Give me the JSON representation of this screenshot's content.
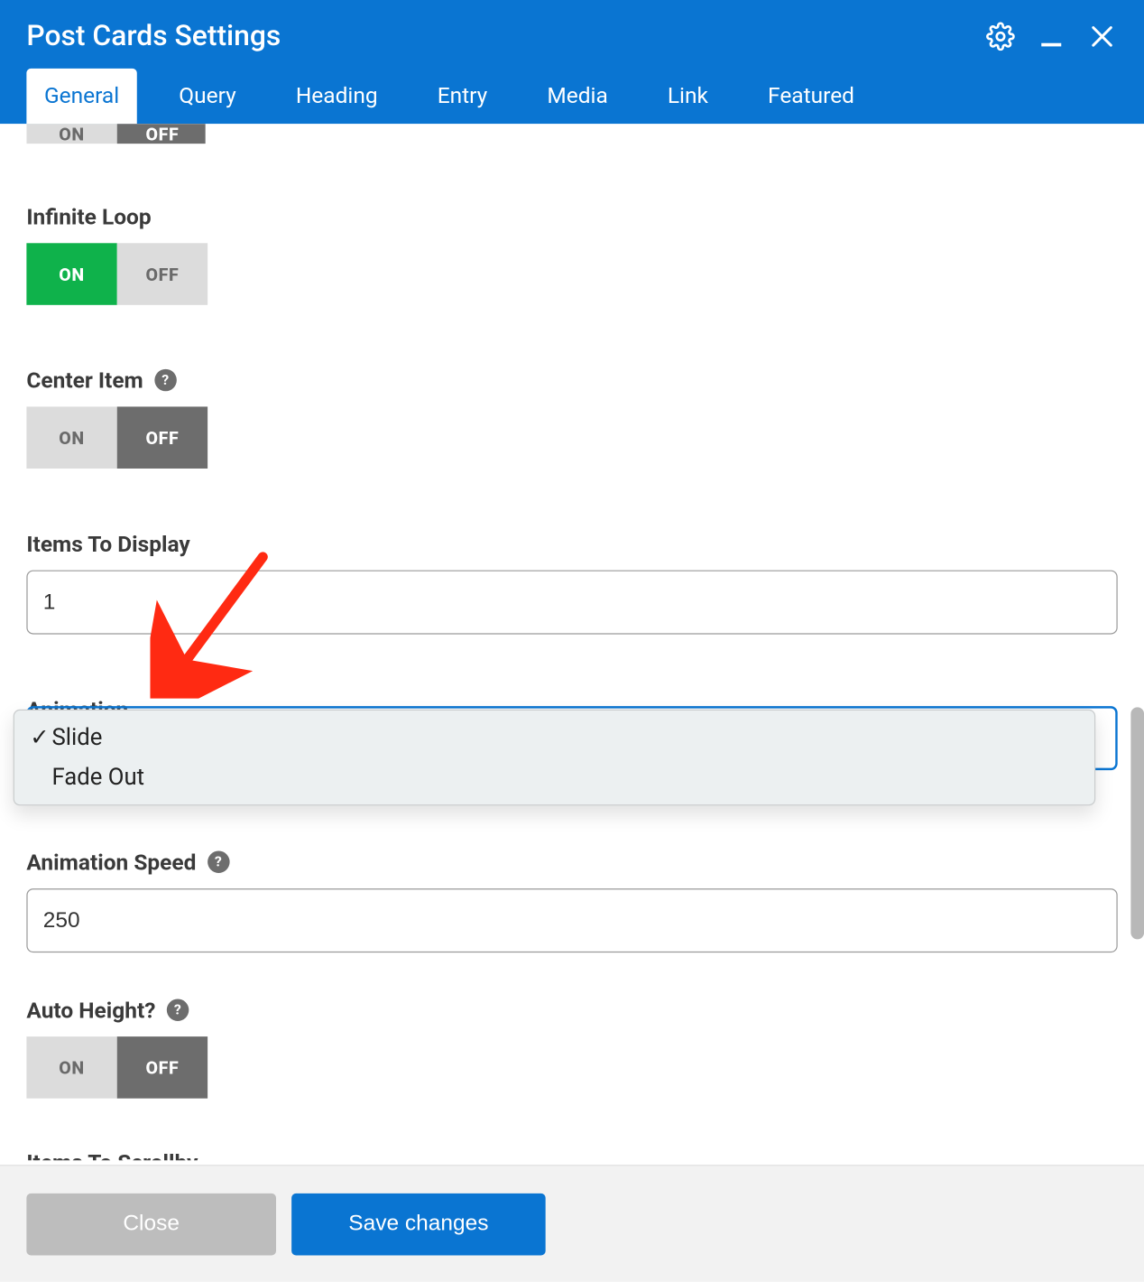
{
  "header": {
    "title": "Post Cards Settings",
    "icons": {
      "settings": "settings-icon",
      "minimize": "minimize-icon",
      "close": "close-icon"
    }
  },
  "tabs": [
    {
      "label": "General",
      "active": true
    },
    {
      "label": "Query",
      "active": false
    },
    {
      "label": "Heading",
      "active": false
    },
    {
      "label": "Entry",
      "active": false
    },
    {
      "label": "Media",
      "active": false
    },
    {
      "label": "Link",
      "active": false
    },
    {
      "label": "Featured",
      "active": false
    }
  ],
  "toggle_labels": {
    "on": "ON",
    "off": "OFF"
  },
  "fields": {
    "partial_prev": {
      "value": "OFF"
    },
    "infinite_loop": {
      "label": "Infinite Loop",
      "value": "ON"
    },
    "center_item": {
      "label": "Center Item",
      "value": "OFF",
      "help": true
    },
    "items_to_display": {
      "label": "Items To Display",
      "value": "1"
    },
    "animation": {
      "label": "Animation",
      "selected": "Slide",
      "options": [
        "Slide",
        "Fade Out"
      ]
    },
    "animation_speed": {
      "label": "Animation Speed",
      "value": "250",
      "help": true
    },
    "auto_height": {
      "label": "Auto Height?",
      "value": "OFF",
      "help": true
    },
    "items_to_scrollby": {
      "label": "Items To Scrollby"
    }
  },
  "footer": {
    "close": "Close",
    "save": "Save changes"
  },
  "annotation": {
    "arrow_color": "#ff2a12"
  }
}
